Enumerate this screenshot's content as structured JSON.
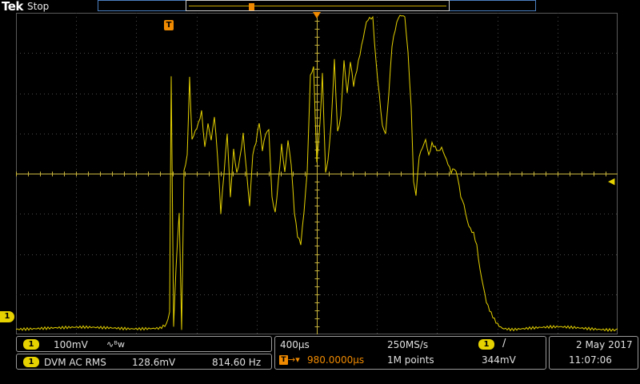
{
  "header": {
    "brand": "Tek",
    "acquisition_status": "Stop"
  },
  "display": {
    "trigger_badge": "T",
    "ch1_marker": "1",
    "trigger_level_marker": "◀",
    "trace_color": "#e6d200",
    "trigger_color": "#f08a00",
    "grid_color": "#4a4a4a"
  },
  "channel_panel": {
    "channel": "1",
    "volts_per_div": "100mV",
    "bandwidth_limit": "∿ᴮw"
  },
  "dvm_panel": {
    "channel": "1",
    "mode": "DVM AC RMS",
    "rms_value": "128.6mV",
    "frequency": "814.60 Hz"
  },
  "horizontal_panel": {
    "time_per_div": "400µs",
    "sample_rate": "250MS/s",
    "trigger_position_icon": "T",
    "trigger_position_arrow": "→▾",
    "trigger_position": "980.0000µs",
    "record_length": "1M points"
  },
  "trigger_panel": {
    "source": "1",
    "slope_icon": "/",
    "level": "344mV"
  },
  "datetime_panel": {
    "date": "2 May  2017",
    "time": "11:07:06"
  }
}
